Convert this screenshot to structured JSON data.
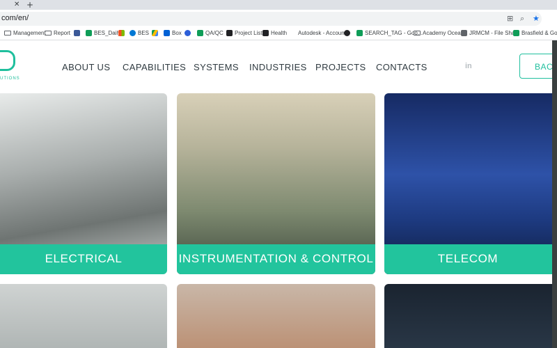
{
  "browser": {
    "url": "com/en/",
    "bookmarks": [
      {
        "label": "Management",
        "icon": "folder-icon",
        "color": "#5f6368"
      },
      {
        "label": "Report",
        "icon": "folder-icon",
        "color": "#5f6368"
      },
      {
        "label": "",
        "icon": "app-icon",
        "color": "#3b5998"
      },
      {
        "label": "BES_Daily",
        "icon": "sheets-icon",
        "color": "#0f9d58"
      },
      {
        "label": "",
        "icon": "office-icon",
        "color": "#f25022"
      },
      {
        "label": "BES",
        "icon": "cloud-icon",
        "color": "#0078d4"
      },
      {
        "label": "",
        "icon": "drive-icon",
        "color": "#fbbc04"
      },
      {
        "label": "Box",
        "icon": "box-icon",
        "color": "#0061d5"
      },
      {
        "label": "",
        "icon": "chat-icon",
        "color": "#2d5fd8"
      },
      {
        "label": "QA/QC",
        "icon": "sheets-icon",
        "color": "#0f9d58"
      },
      {
        "label": "Project List",
        "icon": "list-icon",
        "color": "#202124"
      },
      {
        "label": "Health",
        "icon": "list-icon",
        "color": "#202124"
      },
      {
        "label": "Autodesk - Account",
        "icon": "autodesk-icon",
        "color": "#ffffff"
      },
      {
        "label": "",
        "icon": "circle-icon",
        "color": "#202124"
      },
      {
        "label": "SEARCH_TAG - Goo...",
        "icon": "sheets-icon",
        "color": "#0f9d58"
      },
      {
        "label": "Academy Ocean",
        "icon": "folder-icon",
        "color": "#5f6368"
      },
      {
        "label": "JRMCM - File Share",
        "icon": "share-icon",
        "color": "#5f6368"
      },
      {
        "label": "Brasfield & Gorr",
        "icon": "sheets-icon",
        "color": "#0f9d58"
      }
    ]
  },
  "site": {
    "logo_text": "UTIONS",
    "nav": [
      "ABOUT US",
      "CAPABILITIES",
      "SYSTEMS",
      "INDUSTRIES",
      "PROJECTS",
      "CONTACTS"
    ],
    "linkedin": "in",
    "cta": "BACK"
  },
  "tiles": [
    {
      "label": "ELECTRICAL"
    },
    {
      "label": "INSTRUMENTATION & CONTROL"
    },
    {
      "label": "TELECOM"
    }
  ],
  "colors": {
    "accent": "#22c49d"
  }
}
